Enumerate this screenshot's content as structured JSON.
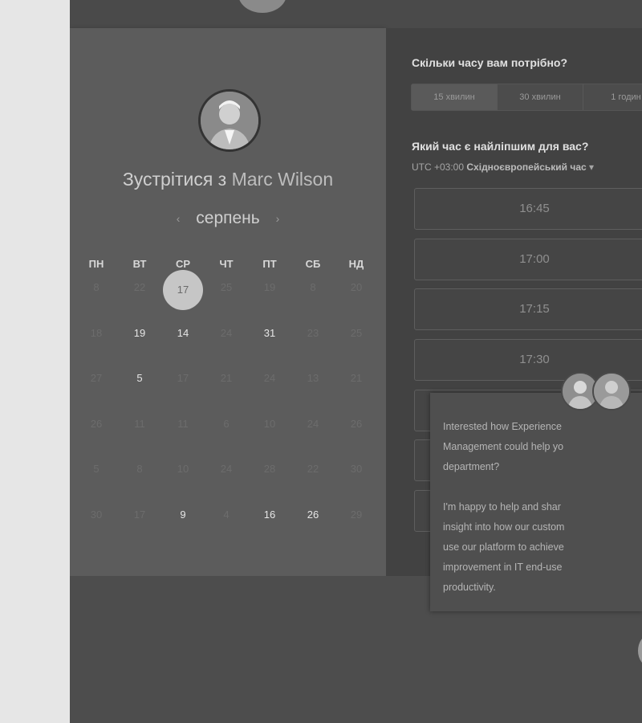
{
  "host": {
    "title_prefix": "Зустрітися з",
    "name": "Marc Wilson"
  },
  "calendar": {
    "month": "серпень",
    "prev_icon": "chevron-left-icon",
    "next_icon": "chevron-right-icon",
    "weekdays": [
      "ПН",
      "ВТ",
      "СР",
      "ЧТ",
      "ПТ",
      "СБ",
      "НД"
    ],
    "weeks": [
      [
        {
          "d": "8"
        },
        {
          "d": "22"
        },
        {
          "d": "17",
          "selected": true
        },
        {
          "d": "25"
        },
        {
          "d": "19"
        },
        {
          "d": "8"
        },
        {
          "d": "20"
        }
      ],
      [
        {
          "d": "18"
        },
        {
          "d": "19",
          "active": true
        },
        {
          "d": "14",
          "active": true
        },
        {
          "d": "24"
        },
        {
          "d": "31",
          "active": true
        },
        {
          "d": "23"
        },
        {
          "d": "25"
        }
      ],
      [
        {
          "d": "27"
        },
        {
          "d": "5",
          "active": true
        },
        {
          "d": "17"
        },
        {
          "d": "21"
        },
        {
          "d": "24"
        },
        {
          "d": "13"
        },
        {
          "d": "21"
        }
      ],
      [
        {
          "d": "26"
        },
        {
          "d": "11"
        },
        {
          "d": "11"
        },
        {
          "d": "6"
        },
        {
          "d": "10"
        },
        {
          "d": "24"
        },
        {
          "d": "26"
        }
      ],
      [
        {
          "d": "5"
        },
        {
          "d": "8"
        },
        {
          "d": "10"
        },
        {
          "d": "24"
        },
        {
          "d": "28"
        },
        {
          "d": "22"
        },
        {
          "d": "30"
        }
      ],
      [
        {
          "d": "30"
        },
        {
          "d": "17"
        },
        {
          "d": "9",
          "active": true
        },
        {
          "d": "4"
        },
        {
          "d": "16",
          "active": true
        },
        {
          "d": "26",
          "active": true
        },
        {
          "d": "29"
        }
      ]
    ]
  },
  "scheduler": {
    "duration_question": "Скільки часу вам потрібно?",
    "durations": [
      {
        "label": "15 хвилин",
        "selected": true
      },
      {
        "label": "30 хвилин"
      },
      {
        "label": "1 годин"
      }
    ],
    "time_question": "Який час є найліпшим для вас?",
    "tz_offset": "UTC +03:00",
    "tz_name": "Східноєвропейський час",
    "tz_dropdown_icon": "caret-down-icon",
    "slots": [
      "16:45",
      "17:00",
      "17:15",
      "17:30",
      "",
      "",
      "",
      ""
    ]
  },
  "chat": {
    "message_1": "Interested how Experience\nManagement could help yo\ndepartment?",
    "message_2": "I'm happy to help and shar\ninsight into how our custom\nuse our platform to achieve\nimprovement in IT end-use\nproductivity."
  }
}
